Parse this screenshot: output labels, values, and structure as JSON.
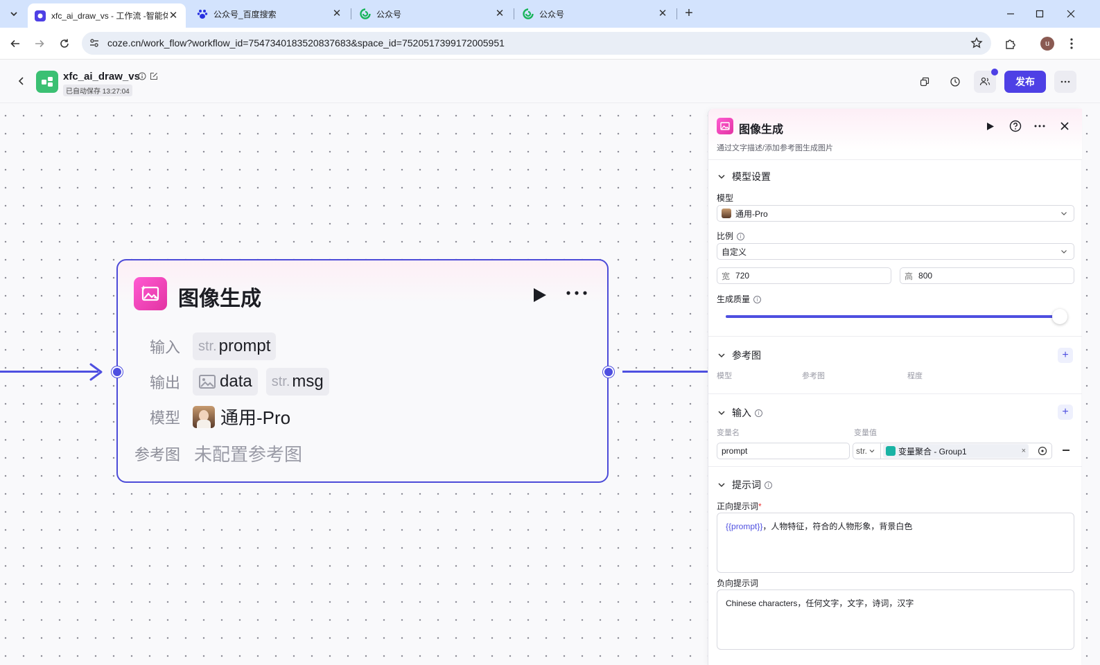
{
  "browser": {
    "tabs": [
      {
        "title": "xfc_ai_draw_vs - 工作流 -智能体",
        "active": true
      },
      {
        "title": "公众号_百度搜索",
        "active": false
      },
      {
        "title": "公众号",
        "active": false
      },
      {
        "title": "公众号",
        "active": false
      }
    ],
    "url": "coze.cn/work_flow?workflow_id=7547340183520837683&space_id=7520517399172005951",
    "profile_initial": "u"
  },
  "app": {
    "name": "xfc_ai_draw_vs",
    "save_status": "已自动保存 13:27:04",
    "publish_label": "发布"
  },
  "node": {
    "title": "图像生成",
    "input_label": "输入",
    "output_label": "输出",
    "model_label": "模型",
    "ref_label": "参考图",
    "input_var": {
      "type": "str.",
      "name": "prompt"
    },
    "output_vars": [
      {
        "type": "image",
        "name": "data"
      },
      {
        "type": "str.",
        "name": "msg"
      }
    ],
    "model_value": "通用-Pro",
    "ref_value": "未配置参考图"
  },
  "panel": {
    "title": "图像生成",
    "description": "通过文字描述/添加参考图生成图片",
    "model_settings": {
      "header": "模型设置",
      "model_label": "模型",
      "model_value": "通用-Pro",
      "ratio_label": "比例",
      "ratio_value": "自定义",
      "width_label": "宽",
      "width_value": "720",
      "height_label": "高",
      "height_value": "800",
      "quality_label": "生成质量",
      "quality_level": 1.0
    },
    "reference": {
      "header": "参考图",
      "col_model": "模型",
      "col_image": "参考图",
      "col_degree": "程度"
    },
    "inputs": {
      "header": "输入",
      "col_name": "变量名",
      "col_value": "变量值",
      "var_name": "prompt",
      "var_type": "str.",
      "var_ref": "变量聚合 - Group1"
    },
    "prompts": {
      "header": "提示词",
      "positive_label": "正向提示词",
      "positive_var": "{{prompt}}",
      "positive_text": "，人物特征，符合的人物形象，背景白色",
      "negative_label": "负向提示词",
      "negative_text": "Chinese characters，任何文字，文字，诗词，汉字"
    }
  },
  "colors": {
    "accent": "#4e40e5",
    "edge": "#4e4fe0",
    "node_icon": "#f04ac0",
    "app_icon": "#3bc073"
  }
}
